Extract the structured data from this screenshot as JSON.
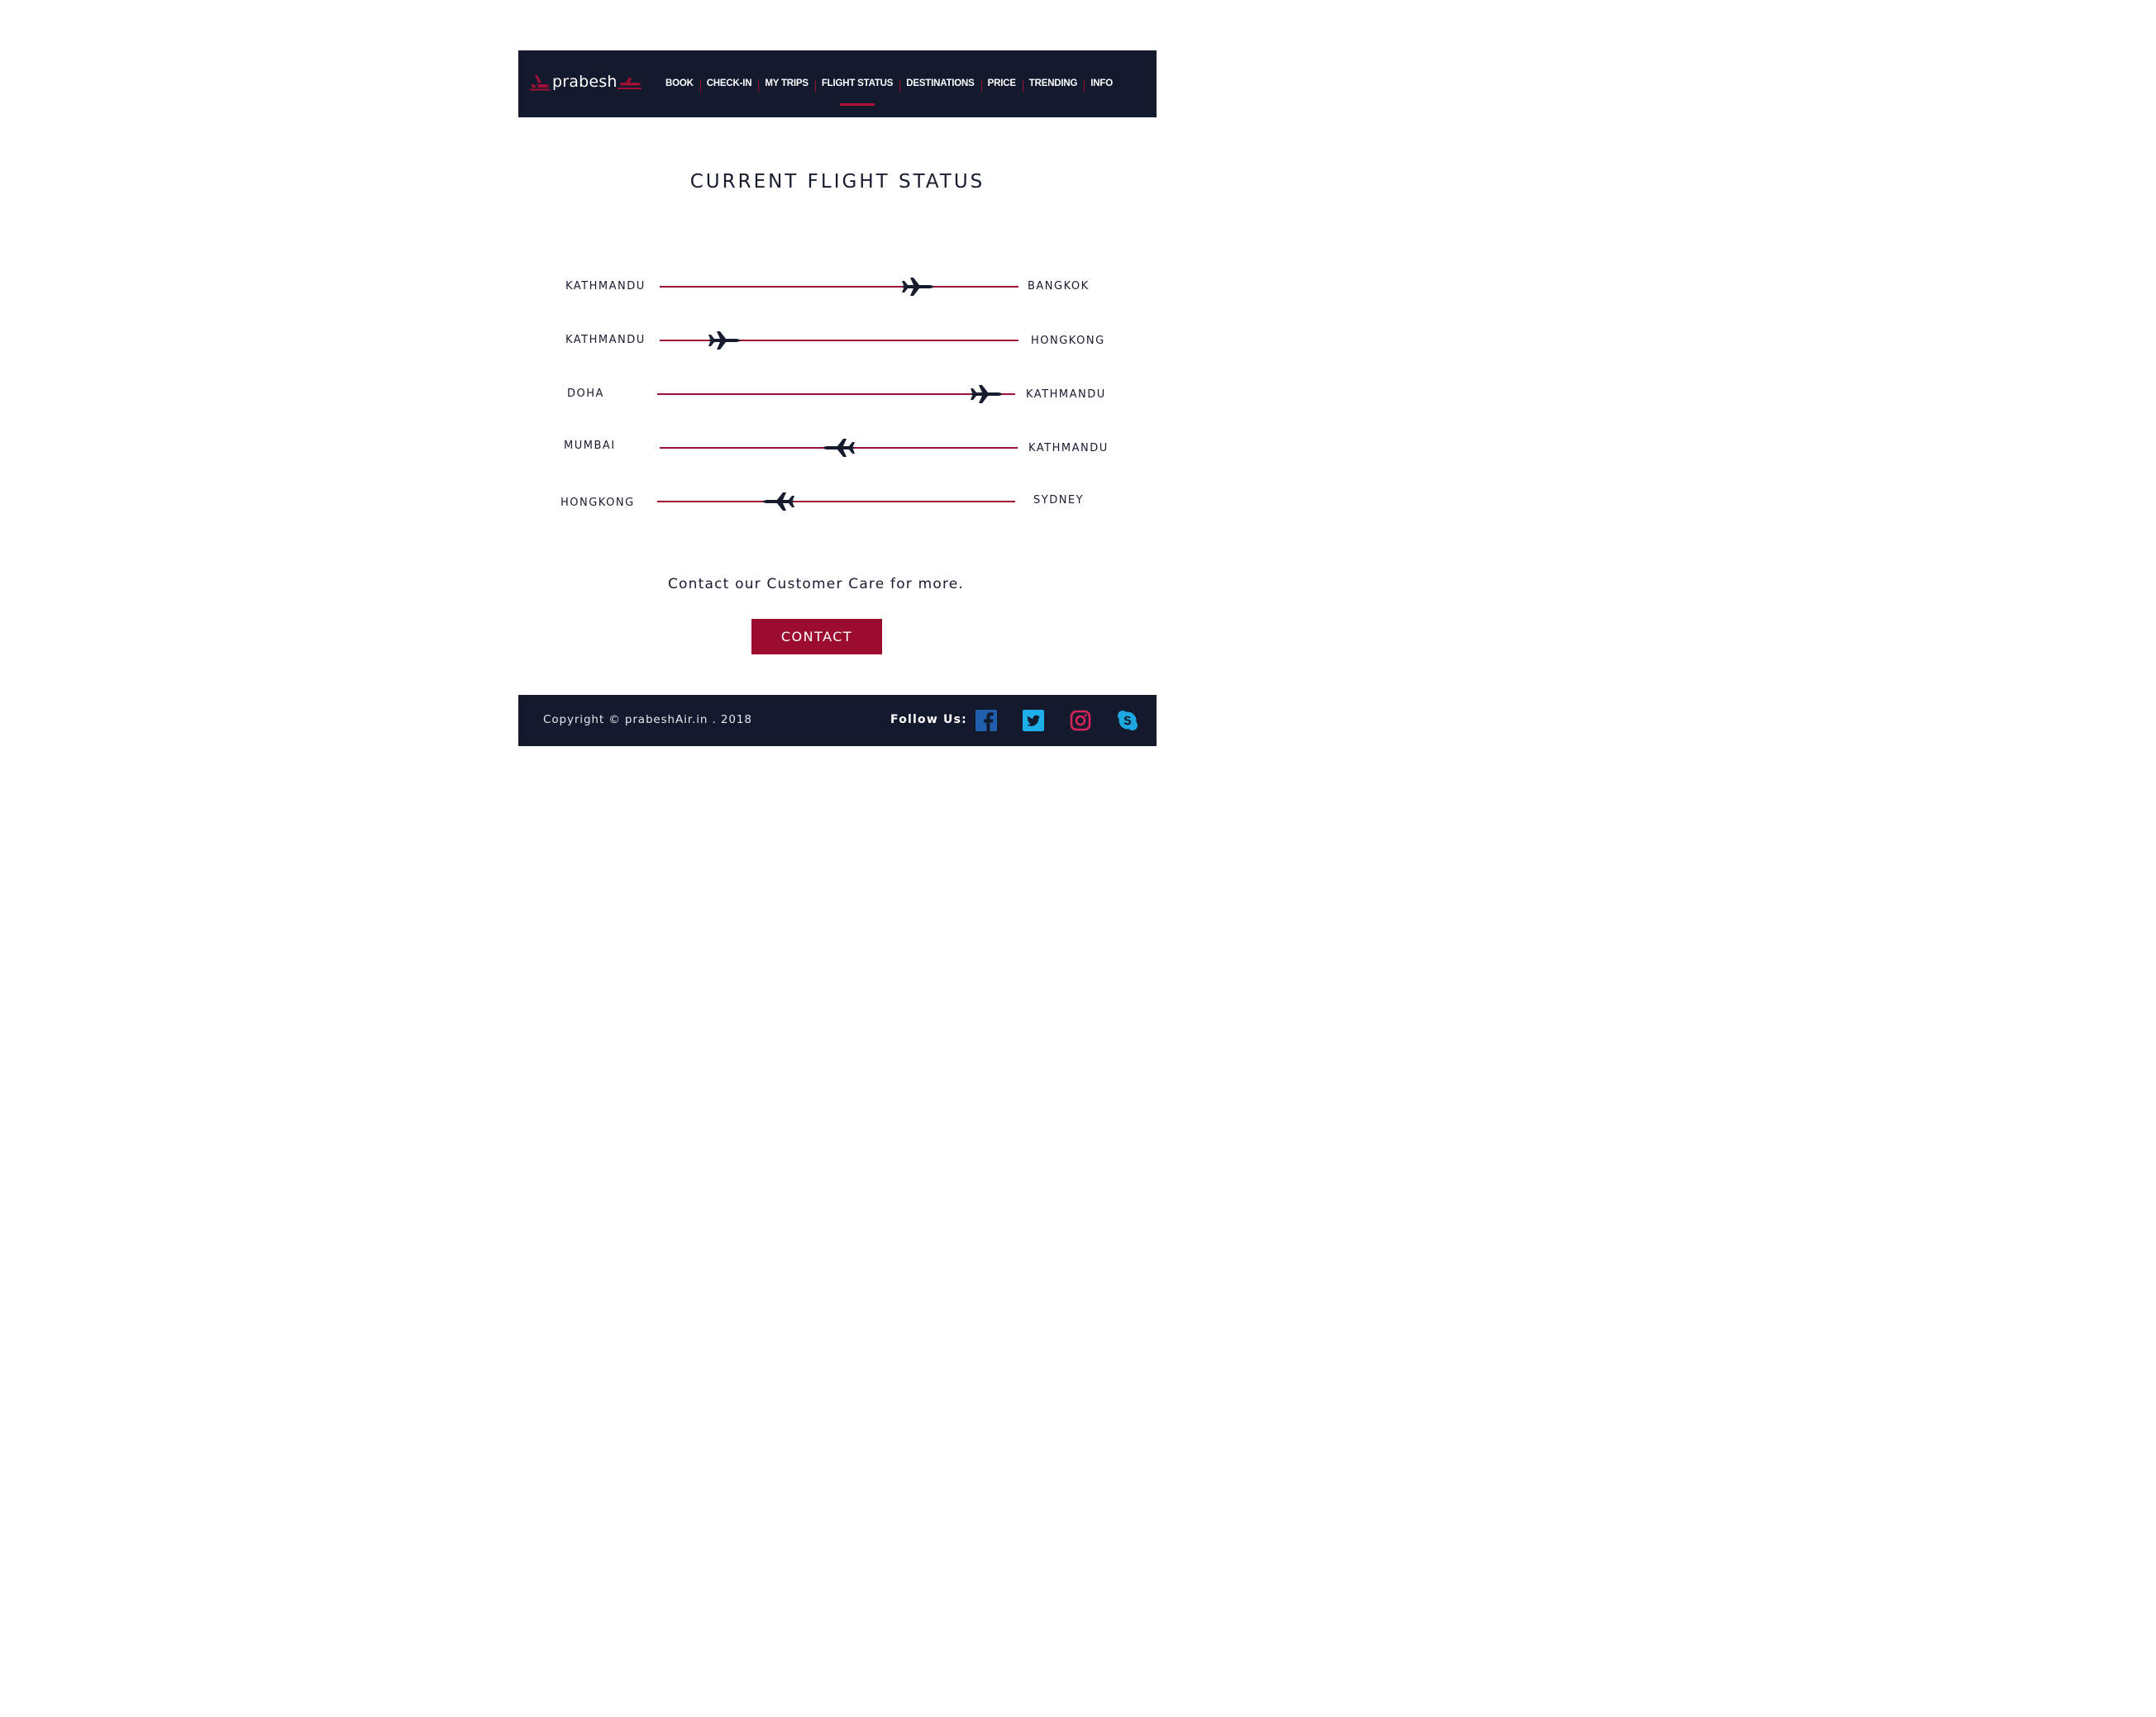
{
  "brand": {
    "name": "prabesh",
    "accent_color": "#a01034",
    "dark_color": "#131a2d"
  },
  "nav": {
    "items": [
      {
        "label": "BOOK"
      },
      {
        "label": "CHECK-IN"
      },
      {
        "label": "MY TRIPS"
      },
      {
        "label": "FLIGHT STATUS",
        "active": true
      },
      {
        "label": "DESTINATIONS"
      },
      {
        "label": "PRICE"
      },
      {
        "label": "TRENDING"
      },
      {
        "label": "INFO"
      }
    ]
  },
  "main": {
    "title": "CURRENT FLIGHT STATUS",
    "flights": [
      {
        "origin": "KATHMANDU",
        "destination": "BANGKOK",
        "progress": 0.72,
        "plane_icon": "plane-right-icon"
      },
      {
        "origin": "KATHMANDU",
        "destination": "HONGKONG",
        "progress": 0.18,
        "plane_icon": "plane-right-icon"
      },
      {
        "origin": "DOHA",
        "destination": "KATHMANDU",
        "progress": 0.92,
        "plane_icon": "plane-right-icon"
      },
      {
        "origin": "MUMBAI",
        "destination": "KATHMANDU",
        "progress": 0.5,
        "plane_icon": "plane-left-icon"
      },
      {
        "origin": "HONGKONG",
        "destination": "SYDNEY",
        "progress": 0.34,
        "plane_icon": "plane-left-icon"
      }
    ],
    "contact_text": "Contact our Customer Care for more.",
    "contact_button": "CONTACT"
  },
  "footer": {
    "copyright": "Copyright © prabeshAir.in . 2018",
    "follow_label": "Follow Us:",
    "social": [
      {
        "name": "facebook-icon",
        "color": "#1f5fae"
      },
      {
        "name": "twitter-icon",
        "color": "#1eaee9"
      },
      {
        "name": "instagram-icon",
        "color": "#d8245c"
      },
      {
        "name": "skype-icon",
        "color": "#1ea7e1"
      }
    ]
  }
}
